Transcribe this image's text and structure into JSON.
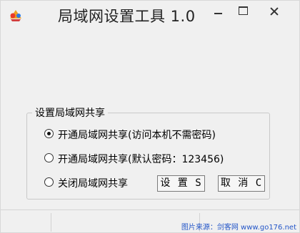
{
  "window": {
    "title": "局域网设置工具 1.0"
  },
  "group": {
    "label": "设置局域网共享",
    "options": [
      {
        "label": "开通局域网共享(访问本机不需密码)",
        "checked": true
      },
      {
        "label": "开通局域网共享(默认密码：123456)",
        "checked": false
      },
      {
        "label": "关闭局域网共享",
        "checked": false
      }
    ]
  },
  "buttons": {
    "set_label": "设 置 S",
    "cancel_label": "取 消 C"
  },
  "watermark": "图片来源：剑客网 www.go176.net"
}
